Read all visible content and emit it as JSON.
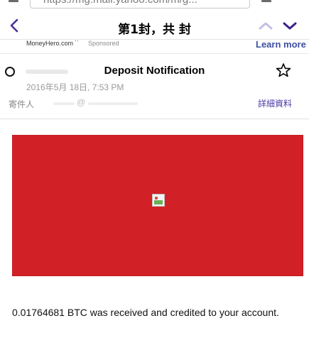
{
  "browser": {
    "url_text": "https://mg.mail.yahoo.com/m/g..."
  },
  "nav": {
    "title": "第1封，共 封"
  },
  "ad": {
    "advertiser": "MoneyHero.com",
    "dots": "··",
    "sponsored": "Sponsored",
    "learn_more": "Learn more"
  },
  "message": {
    "subject": "Deposit Notification",
    "date": "2016年5月 18日, 7:53 PM",
    "from_label": "寄件人",
    "from_at": "@",
    "details_label": "詳細資料"
  },
  "body": {
    "text": "0.01764681 BTC was received and credited to your account."
  },
  "colors": {
    "accent": "#4a2f9d",
    "hero_red": "#d22027",
    "link": "#3e4fa3"
  },
  "icons": {
    "back": "chevron-left-icon",
    "prev": "chevron-up-icon",
    "next": "chevron-down-icon",
    "star": "star-outline-icon",
    "select": "radio-circle-icon"
  }
}
